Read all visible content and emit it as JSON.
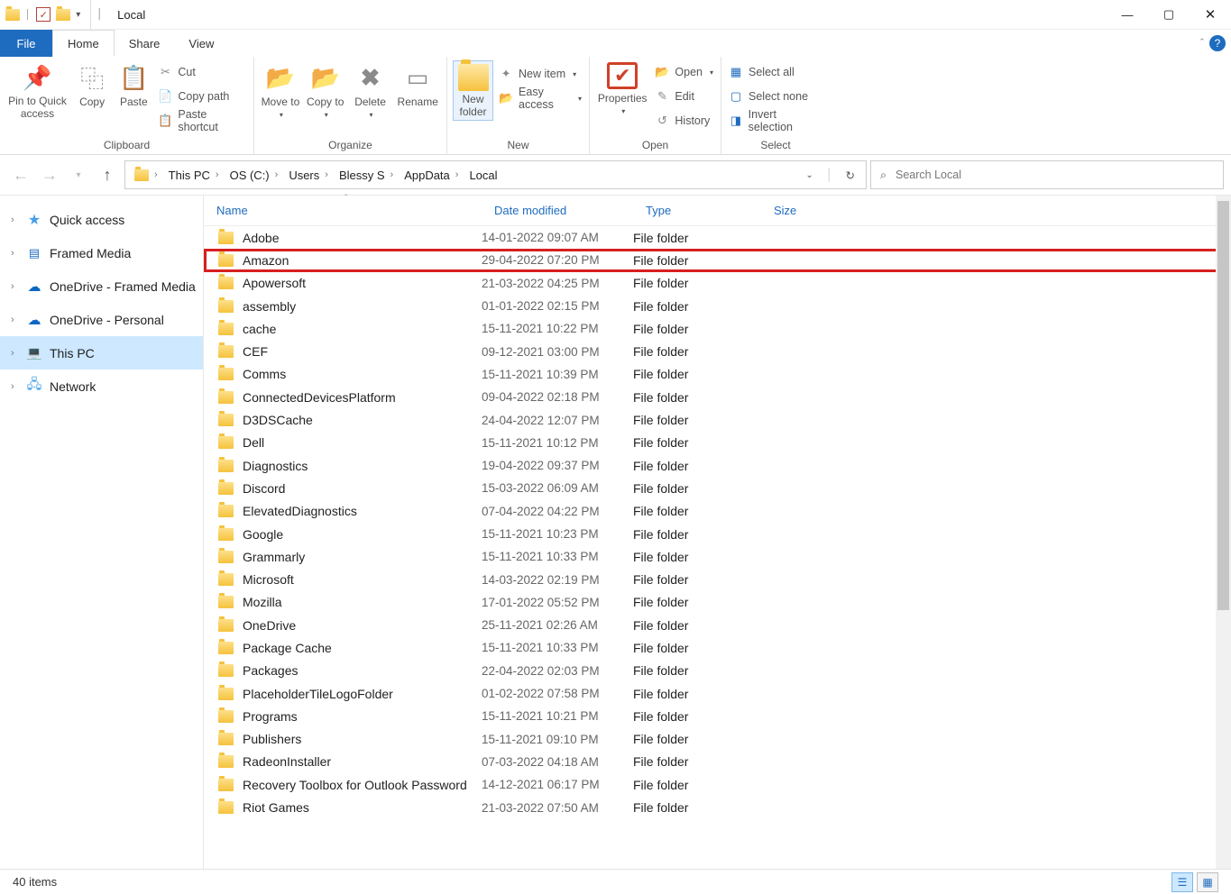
{
  "window": {
    "title": "Local"
  },
  "tabs": {
    "file": "File",
    "home": "Home",
    "share": "Share",
    "view": "View"
  },
  "ribbon": {
    "clipboard": {
      "label": "Clipboard",
      "pin": "Pin to Quick access",
      "copy": "Copy",
      "paste": "Paste",
      "cut": "Cut",
      "copy_path": "Copy path",
      "paste_shortcut": "Paste shortcut"
    },
    "organize": {
      "label": "Organize",
      "move_to": "Move to",
      "copy_to": "Copy to",
      "delete": "Delete",
      "rename": "Rename"
    },
    "new": {
      "label": "New",
      "new_folder": "New folder",
      "new_item": "New item",
      "easy_access": "Easy access"
    },
    "open": {
      "label": "Open",
      "properties": "Properties",
      "open": "Open",
      "edit": "Edit",
      "history": "History"
    },
    "select": {
      "label": "Select",
      "select_all": "Select all",
      "select_none": "Select none",
      "invert": "Invert selection"
    }
  },
  "breadcrumb": [
    "This PC",
    "OS (C:)",
    "Users",
    "Blessy S",
    "AppData",
    "Local"
  ],
  "search": {
    "placeholder": "Search Local"
  },
  "sidebar": [
    {
      "label": "Quick access",
      "icon": "star"
    },
    {
      "label": "Framed Media",
      "icon": "media"
    },
    {
      "label": "OneDrive - Framed Media",
      "icon": "cloud"
    },
    {
      "label": "OneDrive - Personal",
      "icon": "cloud"
    },
    {
      "label": "This PC",
      "icon": "pc",
      "selected": true
    },
    {
      "label": "Network",
      "icon": "net"
    }
  ],
  "columns": {
    "name": "Name",
    "date": "Date modified",
    "type": "Type",
    "size": "Size"
  },
  "rows": [
    {
      "name": "Adobe",
      "date": "14-01-2022 09:07 AM",
      "type": "File folder"
    },
    {
      "name": "Amazon",
      "date": "29-04-2022 07:20 PM",
      "type": "File folder",
      "highlight": true
    },
    {
      "name": "Apowersoft",
      "date": "21-03-2022 04:25 PM",
      "type": "File folder"
    },
    {
      "name": "assembly",
      "date": "01-01-2022 02:15 PM",
      "type": "File folder"
    },
    {
      "name": "cache",
      "date": "15-11-2021 10:22 PM",
      "type": "File folder"
    },
    {
      "name": "CEF",
      "date": "09-12-2021 03:00 PM",
      "type": "File folder"
    },
    {
      "name": "Comms",
      "date": "15-11-2021 10:39 PM",
      "type": "File folder"
    },
    {
      "name": "ConnectedDevicesPlatform",
      "date": "09-04-2022 02:18 PM",
      "type": "File folder"
    },
    {
      "name": "D3DSCache",
      "date": "24-04-2022 12:07 PM",
      "type": "File folder"
    },
    {
      "name": "Dell",
      "date": "15-11-2021 10:12 PM",
      "type": "File folder"
    },
    {
      "name": "Diagnostics",
      "date": "19-04-2022 09:37 PM",
      "type": "File folder"
    },
    {
      "name": "Discord",
      "date": "15-03-2022 06:09 AM",
      "type": "File folder"
    },
    {
      "name": "ElevatedDiagnostics",
      "date": "07-04-2022 04:22 PM",
      "type": "File folder"
    },
    {
      "name": "Google",
      "date": "15-11-2021 10:23 PM",
      "type": "File folder"
    },
    {
      "name": "Grammarly",
      "date": "15-11-2021 10:33 PM",
      "type": "File folder"
    },
    {
      "name": "Microsoft",
      "date": "14-03-2022 02:19 PM",
      "type": "File folder"
    },
    {
      "name": "Mozilla",
      "date": "17-01-2022 05:52 PM",
      "type": "File folder"
    },
    {
      "name": "OneDrive",
      "date": "25-11-2021 02:26 AM",
      "type": "File folder"
    },
    {
      "name": "Package Cache",
      "date": "15-11-2021 10:33 PM",
      "type": "File folder"
    },
    {
      "name": "Packages",
      "date": "22-04-2022 02:03 PM",
      "type": "File folder"
    },
    {
      "name": "PlaceholderTileLogoFolder",
      "date": "01-02-2022 07:58 PM",
      "type": "File folder"
    },
    {
      "name": "Programs",
      "date": "15-11-2021 10:21 PM",
      "type": "File folder"
    },
    {
      "name": "Publishers",
      "date": "15-11-2021 09:10 PM",
      "type": "File folder"
    },
    {
      "name": "RadeonInstaller",
      "date": "07-03-2022 04:18 AM",
      "type": "File folder"
    },
    {
      "name": "Recovery Toolbox for Outlook Password",
      "date": "14-12-2021 06:17 PM",
      "type": "File folder"
    },
    {
      "name": "Riot Games",
      "date": "21-03-2022 07:50 AM",
      "type": "File folder"
    }
  ],
  "status": {
    "count": "40 items"
  }
}
